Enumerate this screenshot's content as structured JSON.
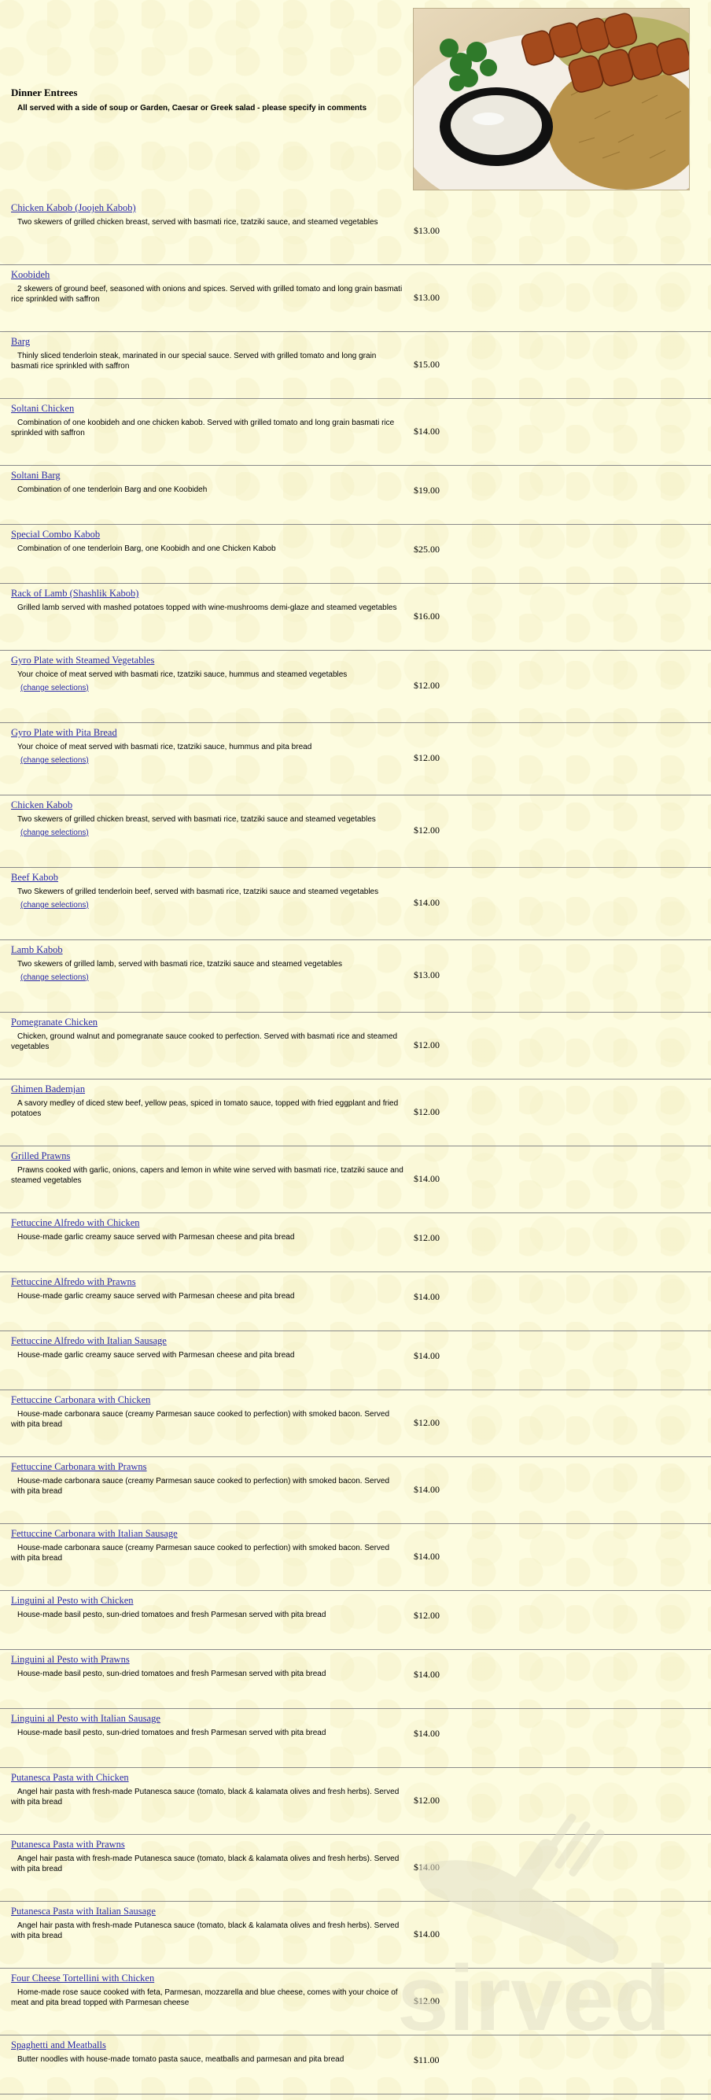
{
  "section": {
    "title": "Dinner Entrees",
    "description": "All served with a side of soup or Garden, Caesar or Greek salad - please specify in comments"
  },
  "change_label": "(change selections)",
  "watermark_text": "sirved",
  "items": [
    {
      "name": "Chicken Kabob (Joojeh Kabob)",
      "desc": "Two skewers of grilled chicken breast, served with basmati rice, tzatziki sauce, and steamed vegetables",
      "price": "$13.00",
      "change": false
    },
    {
      "name": "Koobideh",
      "desc": "2 skewers of ground beef, seasoned with onions and spices. Served with grilled tomato and long grain basmati rice sprinkled with saffron",
      "price": "$13.00",
      "change": false
    },
    {
      "name": "Barg",
      "desc": "Thinly sliced tenderloin steak, marinated in our special sauce. Served with grilled tomato and long grain basmati rice sprinkled with saffron",
      "price": "$15.00",
      "change": false
    },
    {
      "name": "Soltani Chicken",
      "desc": "Combination of one koobideh and one chicken kabob. Served with grilled tomato and long grain basmati rice sprinkled with saffron",
      "price": "$14.00",
      "change": false
    },
    {
      "name": "Soltani Barg",
      "desc": "Combination of one tenderloin Barg and one Koobideh",
      "price": "$19.00",
      "change": false
    },
    {
      "name": "Special Combo Kabob",
      "desc": "Combination of one tenderloin Barg, one Koobidh and one Chicken Kabob",
      "price": "$25.00",
      "change": false
    },
    {
      "name": "Rack of Lamb (Shashlik Kabob)",
      "desc": "Grilled lamb served with mashed potatoes topped with wine-mushrooms demi-glaze and steamed vegetables",
      "price": "$16.00",
      "change": false
    },
    {
      "name": "Gyro Plate with Steamed Vegetables",
      "desc": "Your choice of meat served with basmati rice, tzatziki sauce, hummus and steamed vegetables",
      "price": "$12.00",
      "change": true
    },
    {
      "name": "Gyro Plate with Pita Bread",
      "desc": "Your choice of meat served with basmati rice, tzatziki sauce, hummus and pita bread",
      "price": "$12.00",
      "change": true
    },
    {
      "name": "Chicken Kabob",
      "desc": "Two skewers of grilled chicken breast, served with basmati rice, tzatziki sauce and steamed vegetables",
      "price": "$12.00",
      "change": true
    },
    {
      "name": "Beef Kabob",
      "desc": "Two Skewers of grilled tenderloin beef, served with basmati rice, tzatziki sauce and steamed vegetables",
      "price": "$14.00",
      "change": true
    },
    {
      "name": "Lamb Kabob",
      "desc": "Two skewers of grilled lamb, served with basmati rice, tzatziki sauce and steamed vegetables",
      "price": "$13.00",
      "change": true
    },
    {
      "name": "Pomegranate Chicken",
      "desc": "Chicken, ground walnut and pomegranate sauce cooked to perfection. Served with basmati rice and steamed vegetables",
      "price": "$12.00",
      "change": false
    },
    {
      "name": "Ghimen Bademjan",
      "desc": "A savory medley of diced stew beef, yellow peas, spiced in tomato sauce, topped with fried eggplant and fried potatoes",
      "price": "$12.00",
      "change": false
    },
    {
      "name": "Grilled Prawns",
      "desc": "Prawns cooked with garlic, onions, capers and lemon in white wine served with basmati rice, tzatziki sauce and steamed vegetables",
      "price": "$14.00",
      "change": false
    },
    {
      "name": "Fettuccine Alfredo with Chicken",
      "desc": "House-made garlic creamy sauce served with Parmesan cheese and pita bread",
      "price": "$12.00",
      "change": false
    },
    {
      "name": "Fettuccine Alfredo with Prawns",
      "desc": "House-made garlic creamy sauce served with Parmesan cheese and pita bread",
      "price": "$14.00",
      "change": false
    },
    {
      "name": "Fettuccine Alfredo with Italian Sausage",
      "desc": "House-made garlic creamy sauce served with Parmesan cheese and pita bread",
      "price": "$14.00",
      "change": false
    },
    {
      "name": "Fettuccine Carbonara with Chicken",
      "desc": "House-made carbonara sauce (creamy Parmesan sauce cooked to perfection) with smoked bacon. Served with pita bread",
      "price": "$12.00",
      "change": false
    },
    {
      "name": "Fettuccine Carbonara with Prawns",
      "desc": "House-made carbonara sauce (creamy Parmesan sauce cooked to perfection) with smoked bacon. Served with pita bread",
      "price": "$14.00",
      "change": false
    },
    {
      "name": "Fettuccine Carbonara with Italian Sausage",
      "desc": "House-made carbonara sauce (creamy Parmesan sauce cooked to perfection) with smoked bacon. Served with pita bread",
      "price": "$14.00",
      "change": false
    },
    {
      "name": "Linguini al Pesto with Chicken",
      "desc": "House-made basil pesto, sun-dried tomatoes and fresh Parmesan served with pita bread",
      "price": "$12.00",
      "change": false
    },
    {
      "name": "Linguini al Pesto with Prawns",
      "desc": "House-made basil pesto, sun-dried tomatoes and fresh Parmesan served with pita bread",
      "price": "$14.00",
      "change": false
    },
    {
      "name": "Linguini al Pesto with Italian Sausage",
      "desc": "House-made basil pesto, sun-dried tomatoes and fresh Parmesan served with pita bread",
      "price": "$14.00",
      "change": false
    },
    {
      "name": "Putanesca Pasta with Chicken",
      "desc": "Angel hair pasta with fresh-made Putanesca sauce (tomato, black & kalamata olives and fresh herbs). Served with pita bread",
      "price": "$12.00",
      "change": false
    },
    {
      "name": "Putanesca Pasta with Prawns",
      "desc": "Angel hair pasta with fresh-made Putanesca sauce (tomato, black & kalamata olives and fresh herbs). Served with pita bread",
      "price": "$14.00",
      "change": false
    },
    {
      "name": "Putanesca Pasta with Italian Sausage",
      "desc": "Angel hair pasta with fresh-made Putanesca sauce (tomato, black & kalamata olives and fresh herbs). Served with pita bread",
      "price": "$14.00",
      "change": false
    },
    {
      "name": "Four Cheese Tortellini with Chicken",
      "desc": "Home-made rose sauce cooked with feta, Parmesan, mozzarella and blue cheese, comes with your choice of meat and pita bread topped with Parmesan cheese",
      "price": "$12.00",
      "change": false
    },
    {
      "name": "Spaghetti and Meatballs",
      "desc": "Butter noodles with house-made tomato pasta sauce, meatballs and parmesan and pita bread",
      "price": "$11.00",
      "change": false
    }
  ]
}
